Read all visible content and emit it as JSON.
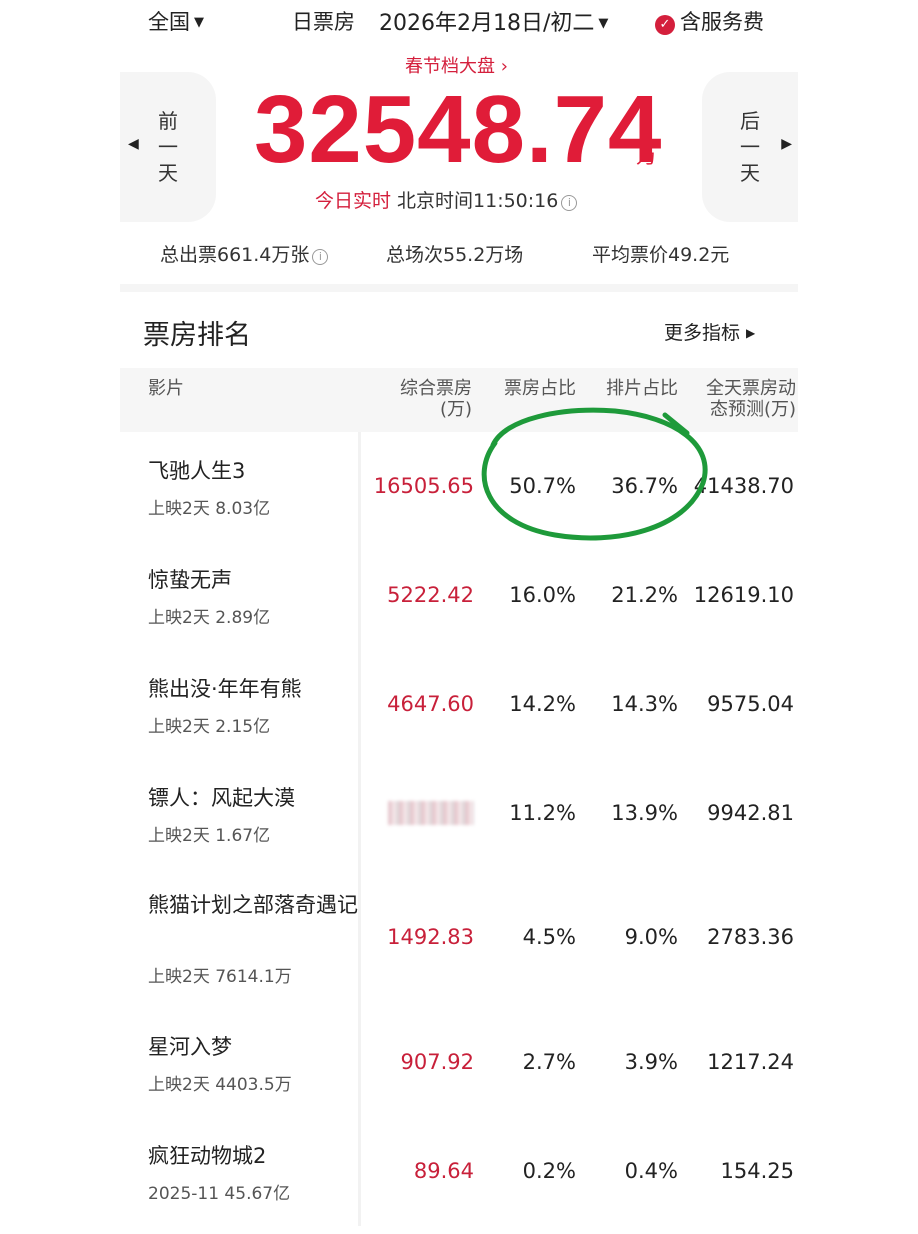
{
  "header": {
    "region": "全国",
    "mode": "日票房",
    "date": "2026年2月18日/初二",
    "service_fee": "含服务费",
    "season_link": "春节档大盘",
    "total_box": "32548.74",
    "total_unit": "万",
    "realtime_label": "今日实时",
    "realtime_time": "北京时间11:50:16",
    "prev_label": [
      "前",
      "一",
      "天"
    ],
    "next_label": [
      "后",
      "一",
      "天"
    ]
  },
  "stats": {
    "tickets": "总出票661.4万张",
    "shows": "总场次55.2万场",
    "avg_price": "平均票价49.2元"
  },
  "ranking": {
    "title": "票房排名",
    "more": "更多指标",
    "columns": {
      "movie": "影片",
      "box_line1": "综合票房",
      "box_line2": "(万)",
      "share": "票房占比",
      "screen": "排片占比",
      "forecast_line1": "全天票房动",
      "forecast_line2": "态预测(万)"
    },
    "rows": [
      {
        "name": "飞驰人生3",
        "sub": "上映2天  8.03亿",
        "box": "16505.65",
        "share": "50.7%",
        "screen": "36.7%",
        "forecast": "41438.70"
      },
      {
        "name": "惊蛰无声",
        "sub": "上映2天  2.89亿",
        "box": "5222.42",
        "share": "16.0%",
        "screen": "21.2%",
        "forecast": "12619.10"
      },
      {
        "name": "熊出没·年年有熊",
        "sub": "上映2天  2.15亿",
        "box": "4647.60",
        "share": "14.2%",
        "screen": "14.3%",
        "forecast": "9575.04"
      },
      {
        "name": "镖人：风起大漠",
        "sub": "上映2天  1.67亿",
        "box": "",
        "share": "11.2%",
        "screen": "13.9%",
        "forecast": "9942.81"
      },
      {
        "name": "熊猫计划之部落奇遇记",
        "sub": "上映2天  7614.1万",
        "box": "1492.83",
        "share": "4.5%",
        "screen": "9.0%",
        "forecast": "2783.36"
      },
      {
        "name": "星河入梦",
        "sub": "上映2天  4403.5万",
        "box": "907.92",
        "share": "2.7%",
        "screen": "3.9%",
        "forecast": "1217.24"
      },
      {
        "name": "疯狂动物城2",
        "sub": "2025-11  45.67亿",
        "box": "89.64",
        "share": "0.2%",
        "screen": "0.4%",
        "forecast": "154.25"
      }
    ]
  },
  "colors": {
    "accent_red": "#e01c38",
    "box_red": "#c8203a",
    "annotation_green": "#1e9a3a"
  }
}
